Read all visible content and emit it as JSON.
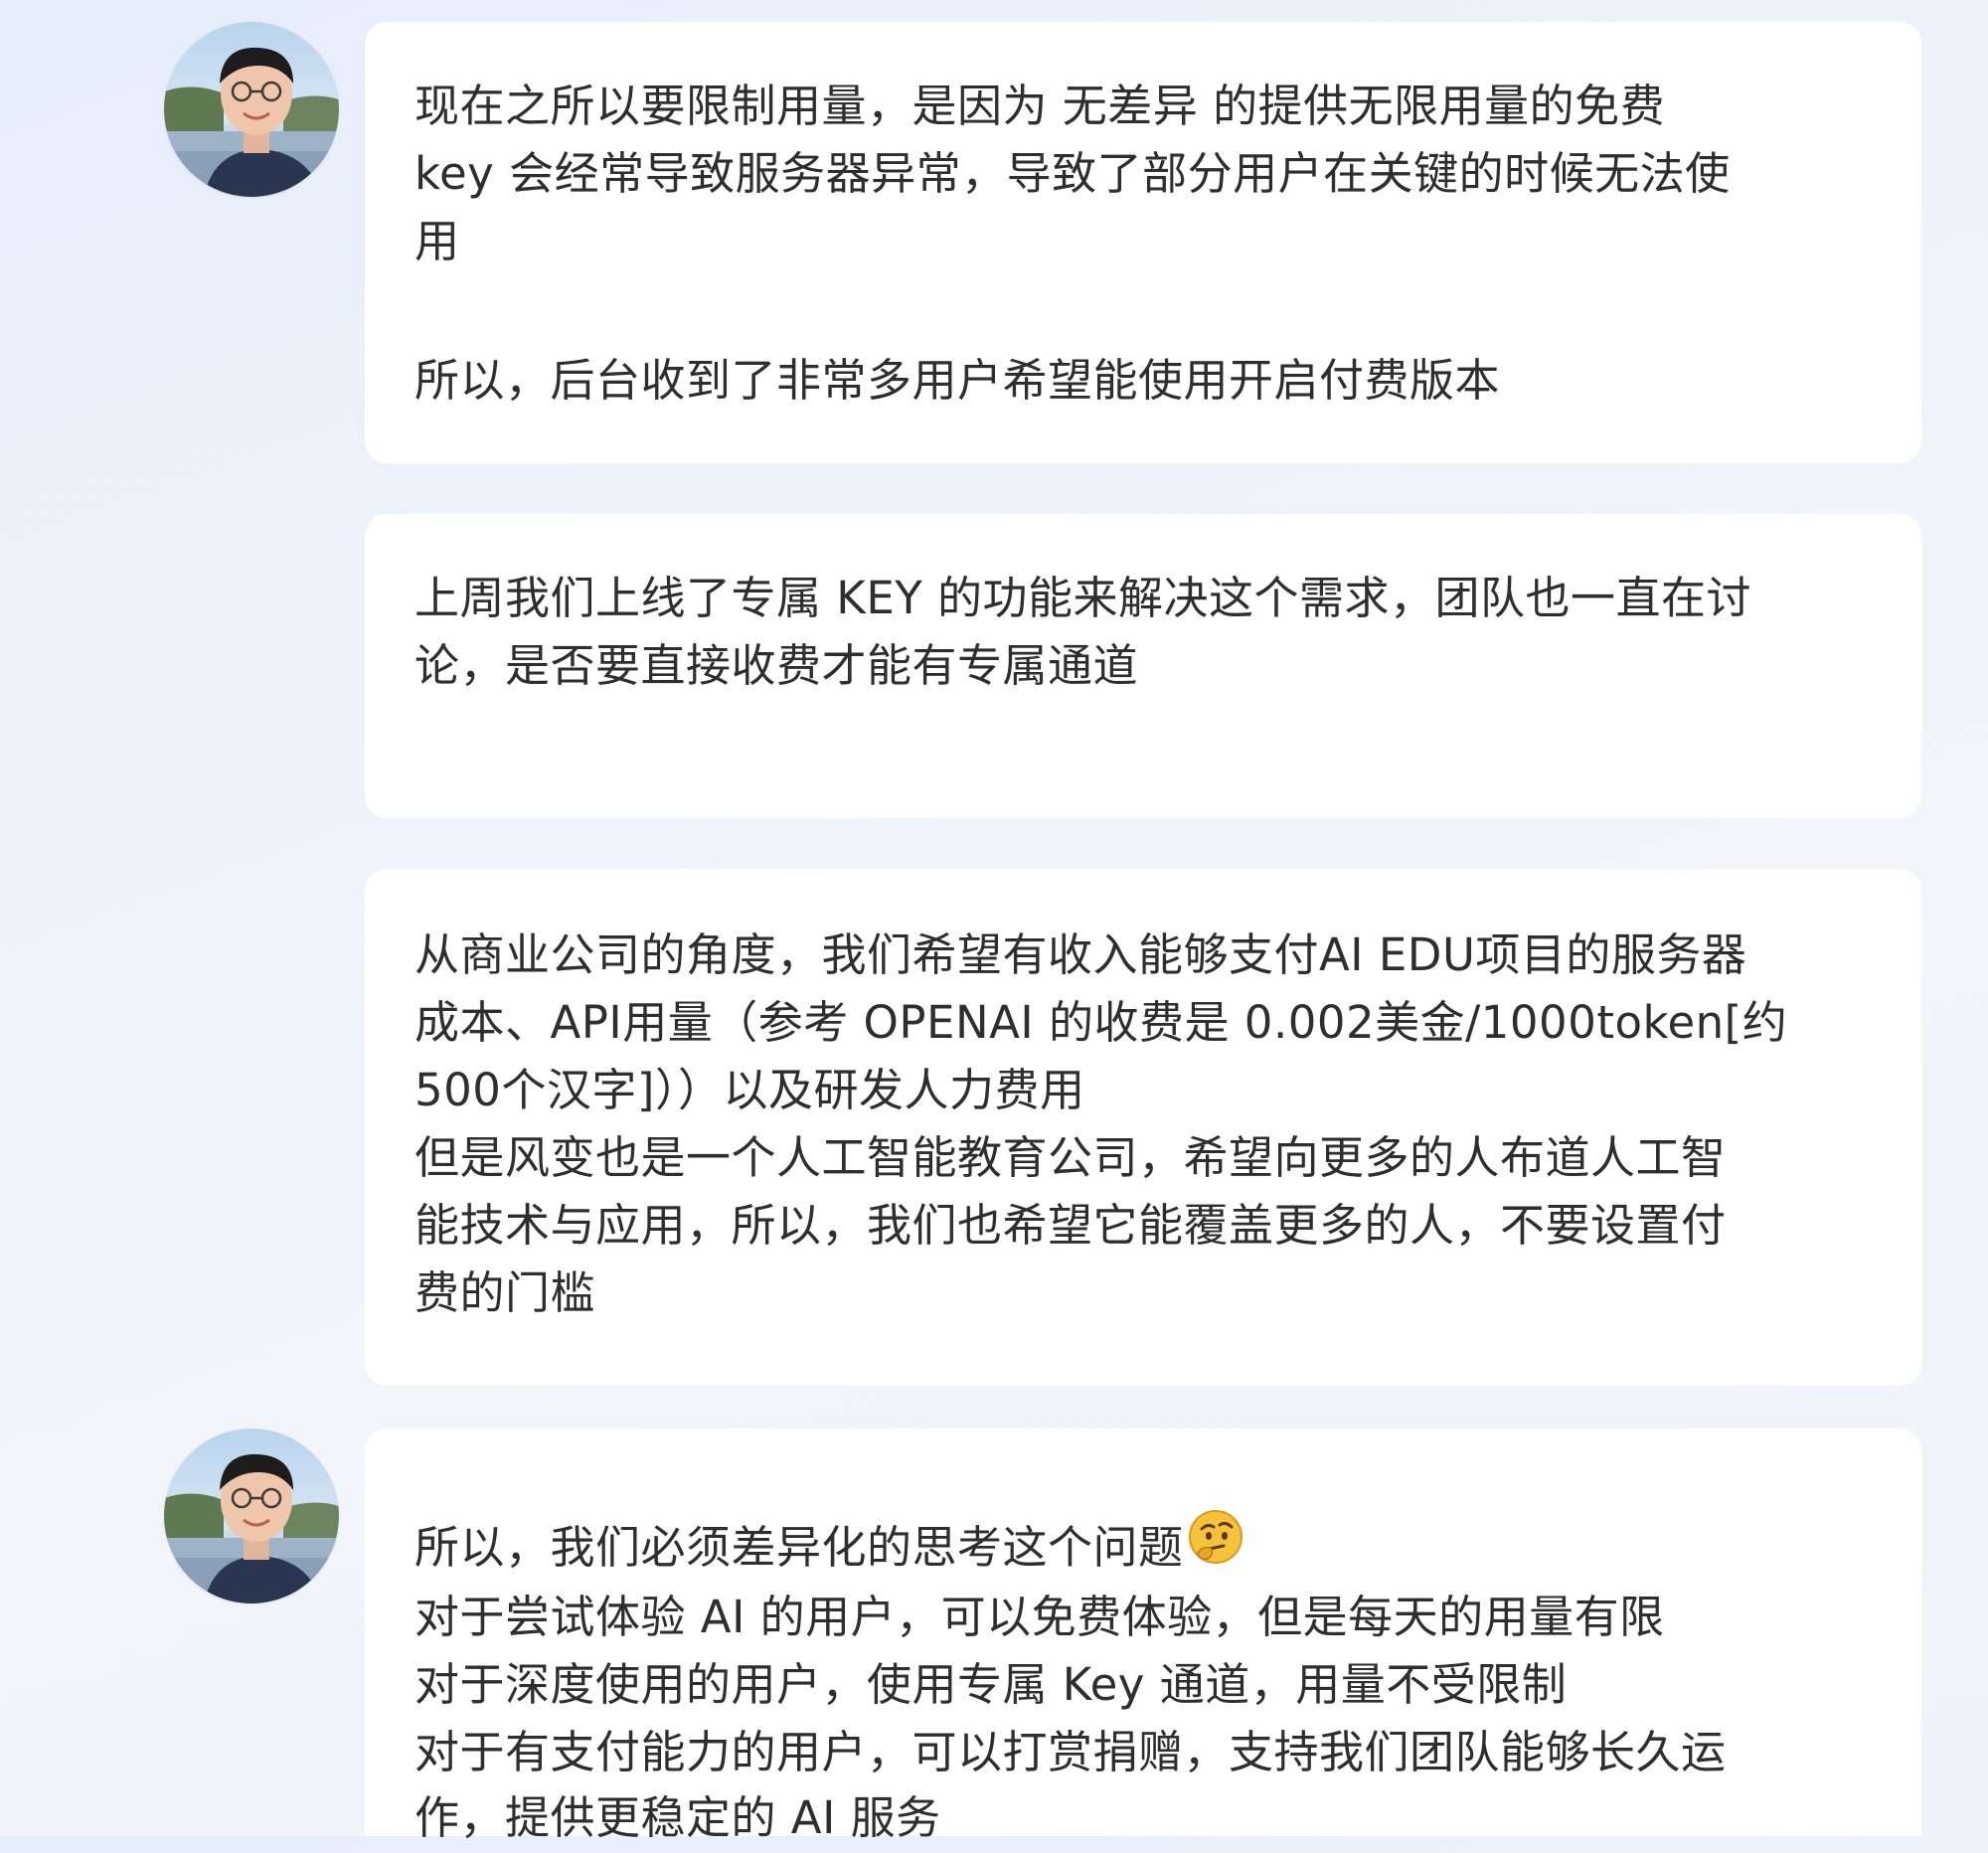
{
  "messages": [
    {
      "lines": [
        "现在之所以要限制用量，是因为 无差异 的提供无限用量的免费",
        "key 会经常导致服务器异常，导致了部分用户在关键的时候无法使",
        "用",
        "所以，后台收到了非常多用户希望能使用开启付费版本"
      ]
    },
    {
      "lines": [
        "上周我们上线了专属 KEY 的功能来解决这个需求，团队也一直在讨",
        "论，是否要直接收费才能有专属通道"
      ]
    },
    {
      "lines": [
        "从商业公司的角度，我们希望有收入能够支付AI EDU项目的服务器",
        "成本、API用量（参考 OPENAI 的收费是 0.002美金/1000token[约",
        "500个汉字]））以及研发人力费用",
        "但是风变也是一个人工智能教育公司，希望向更多的人布道人工智",
        "能技术与应用，所以，我们也希望它能覆盖更多的人，不要设置付",
        "费的门槛"
      ]
    },
    {
      "lines": [
        "所以，我们必须差异化的思考这个问题",
        "对于尝试体验 AI 的用户，可以免费体验，但是每天的用量有限",
        "对于深度使用的用户，使用专属 Key 通道，用量不受限制",
        "对于有支付能力的用户，可以打赏捐赠，支持我们团队能够长久运",
        "作，提供更稳定的 AI 服务"
      ],
      "emoji": "thinking-face-emoji"
    }
  ]
}
